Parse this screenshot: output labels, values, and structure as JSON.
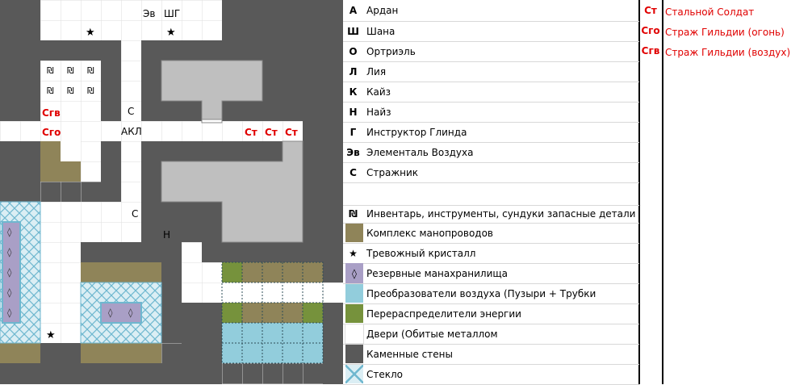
{
  "map": {
    "labels": {
      "ev": "Эв",
      "shg": "ШГ",
      "s1": "С",
      "akl": "АКЛ",
      "s2": "С",
      "n": "Н",
      "sgv": "Сгв",
      "sgo": "Сго",
      "st1": "Ст",
      "st2": "Ст",
      "st3": "Ст"
    },
    "symbols": {
      "star": "★",
      "inventory": "₪",
      "diamond": "◊"
    }
  },
  "legend": {
    "rows": [
      {
        "key": "А",
        "text": "Ардан"
      },
      {
        "key": "Ш",
        "text": "Шана"
      },
      {
        "key": "О",
        "text": "Ортриэль"
      },
      {
        "key": "Л",
        "text": "Лия"
      },
      {
        "key": "К",
        "text": "Кайз"
      },
      {
        "key": "Н",
        "text": "Найз"
      },
      {
        "key": "Г",
        "text": "Инструктор Глинда"
      },
      {
        "key": "Эв",
        "text": "Элементаль Воздуха"
      },
      {
        "key": "С",
        "text": "Стражник"
      },
      {
        "key": "",
        "text": ""
      },
      {
        "key": "₪",
        "text": "Инвентарь, инструменты, сундуки запасные детали"
      },
      {
        "key": "",
        "text": "Комплекс манопроводов",
        "swatch": "#8f8459"
      },
      {
        "key": "★",
        "text": "Тревожный кристалл"
      },
      {
        "key": "◊",
        "text": "Резервные манахранилища",
        "swatch": "#a99fc6"
      },
      {
        "key": "",
        "text": "Преобразователи воздуха (Пузыри + Трубки",
        "swatch": "#92cddc"
      },
      {
        "key": "",
        "text": "Перераспределители энергии",
        "swatch": "#76923c"
      },
      {
        "key": "",
        "text": "Двери (Обитые металлом",
        "swatch": "#ffffff"
      },
      {
        "key": "",
        "text": "Каменные стены",
        "swatch": "#595959"
      },
      {
        "key": "",
        "text": "Стекло",
        "swatch": "glass"
      }
    ],
    "enemies": [
      {
        "key": "Ст",
        "text": "Стальной Солдат"
      },
      {
        "key": "Сго",
        "text": "Страж Гильдии (огонь)"
      },
      {
        "key": "Сгв",
        "text": "Страж Гильдии (воздух)"
      }
    ]
  },
  "colors": {
    "stone": "#595959",
    "floor": "#ffffff",
    "grid": "#d9d9d9",
    "room": "#bfbfbf",
    "conduit": "#8f8459",
    "energy": "#76923c",
    "air": "#92cddc",
    "reserve": "#a99fc6",
    "glass": "#dbeef4",
    "red": "#e00000"
  }
}
